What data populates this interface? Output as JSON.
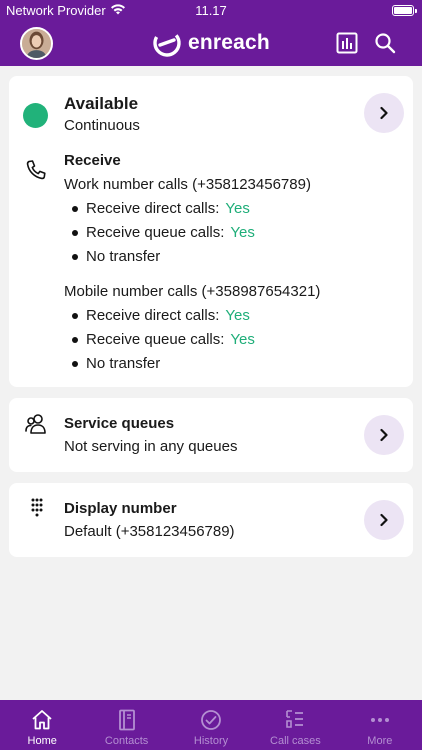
{
  "status_bar": {
    "provider": "Network Provider",
    "time": "11.17"
  },
  "header": {
    "logo_text": "enreach"
  },
  "availability": {
    "title": "Available",
    "subtitle": "Continuous",
    "dot_color": "#21b27a"
  },
  "receive": {
    "title": "Receive",
    "groups": [
      {
        "title": "Work number calls (+358123456789)",
        "items": [
          {
            "label": "Receive direct calls:",
            "value": "Yes"
          },
          {
            "label": "Receive queue calls:",
            "value": "Yes"
          },
          {
            "label": "No transfer",
            "value": ""
          }
        ]
      },
      {
        "title": "Mobile number calls (+358987654321)",
        "items": [
          {
            "label": "Receive direct calls:",
            "value": "Yes"
          },
          {
            "label": "Receive queue calls:",
            "value": "Yes"
          },
          {
            "label": "No transfer",
            "value": ""
          }
        ]
      }
    ]
  },
  "service_queues": {
    "title": "Service queues",
    "subtitle": "Not serving in any queues"
  },
  "display_number": {
    "title": "Display number",
    "subtitle": "Default (+358123456789)"
  },
  "tabs": [
    {
      "label": "Home",
      "icon": "home-icon",
      "active": true
    },
    {
      "label": "Contacts",
      "icon": "contacts-icon",
      "active": false
    },
    {
      "label": "History",
      "icon": "history-icon",
      "active": false
    },
    {
      "label": "Call cases",
      "icon": "call-cases-icon",
      "active": false
    },
    {
      "label": "More",
      "icon": "more-icon",
      "active": false
    }
  ],
  "colors": {
    "brand": "#6a1b9a",
    "accent_green": "#21b27a",
    "chevron_bg": "#ece4f4"
  }
}
